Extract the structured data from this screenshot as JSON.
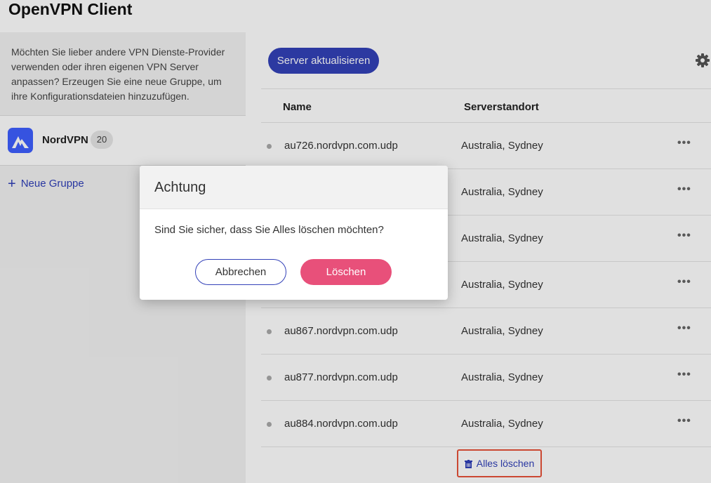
{
  "app": {
    "title": "OpenVPN Client"
  },
  "sidebar": {
    "info": "Möchten Sie lieber andere VPN Dienste-Provider verwenden oder ihren eigenen VPN Server anpassen? Erzeugen Sie eine neue Gruppe, um ihre Konfigurationsdateien hinzuzufügen.",
    "group": {
      "name": "NordVPN",
      "count": "20",
      "logo_color": "#3e5fff"
    },
    "new_group_label": "Neue Gruppe"
  },
  "main": {
    "refresh_label": "Server aktualisieren",
    "columns": {
      "name": "Name",
      "location": "Serverstandort"
    },
    "servers": [
      {
        "name": "au726.nordvpn.com.udp",
        "location": "Australia, Sydney"
      },
      {
        "name": "",
        "location": "Australia, Sydney"
      },
      {
        "name": "",
        "location": "Australia, Sydney"
      },
      {
        "name": "",
        "location": "Australia, Sydney"
      },
      {
        "name": "au867.nordvpn.com.udp",
        "location": "Australia, Sydney"
      },
      {
        "name": "au877.nordvpn.com.udp",
        "location": "Australia, Sydney"
      },
      {
        "name": "au884.nordvpn.com.udp",
        "location": "Australia, Sydney"
      }
    ],
    "more_glyph": "•••",
    "delete_all_label": "Alles löschen"
  },
  "dialog": {
    "title": "Achtung",
    "message": "Sind Sie sicher, dass Sie Alles löschen möchten?",
    "cancel_label": "Abbrechen",
    "confirm_label": "Löschen",
    "confirm_color": "#e8507a"
  },
  "colors": {
    "accent": "#3341b8",
    "highlight_border": "#e8533a"
  },
  "icons": [
    "nordvpn-logo-icon",
    "plus-icon",
    "gear-icon",
    "more-icon",
    "trash-icon"
  ]
}
